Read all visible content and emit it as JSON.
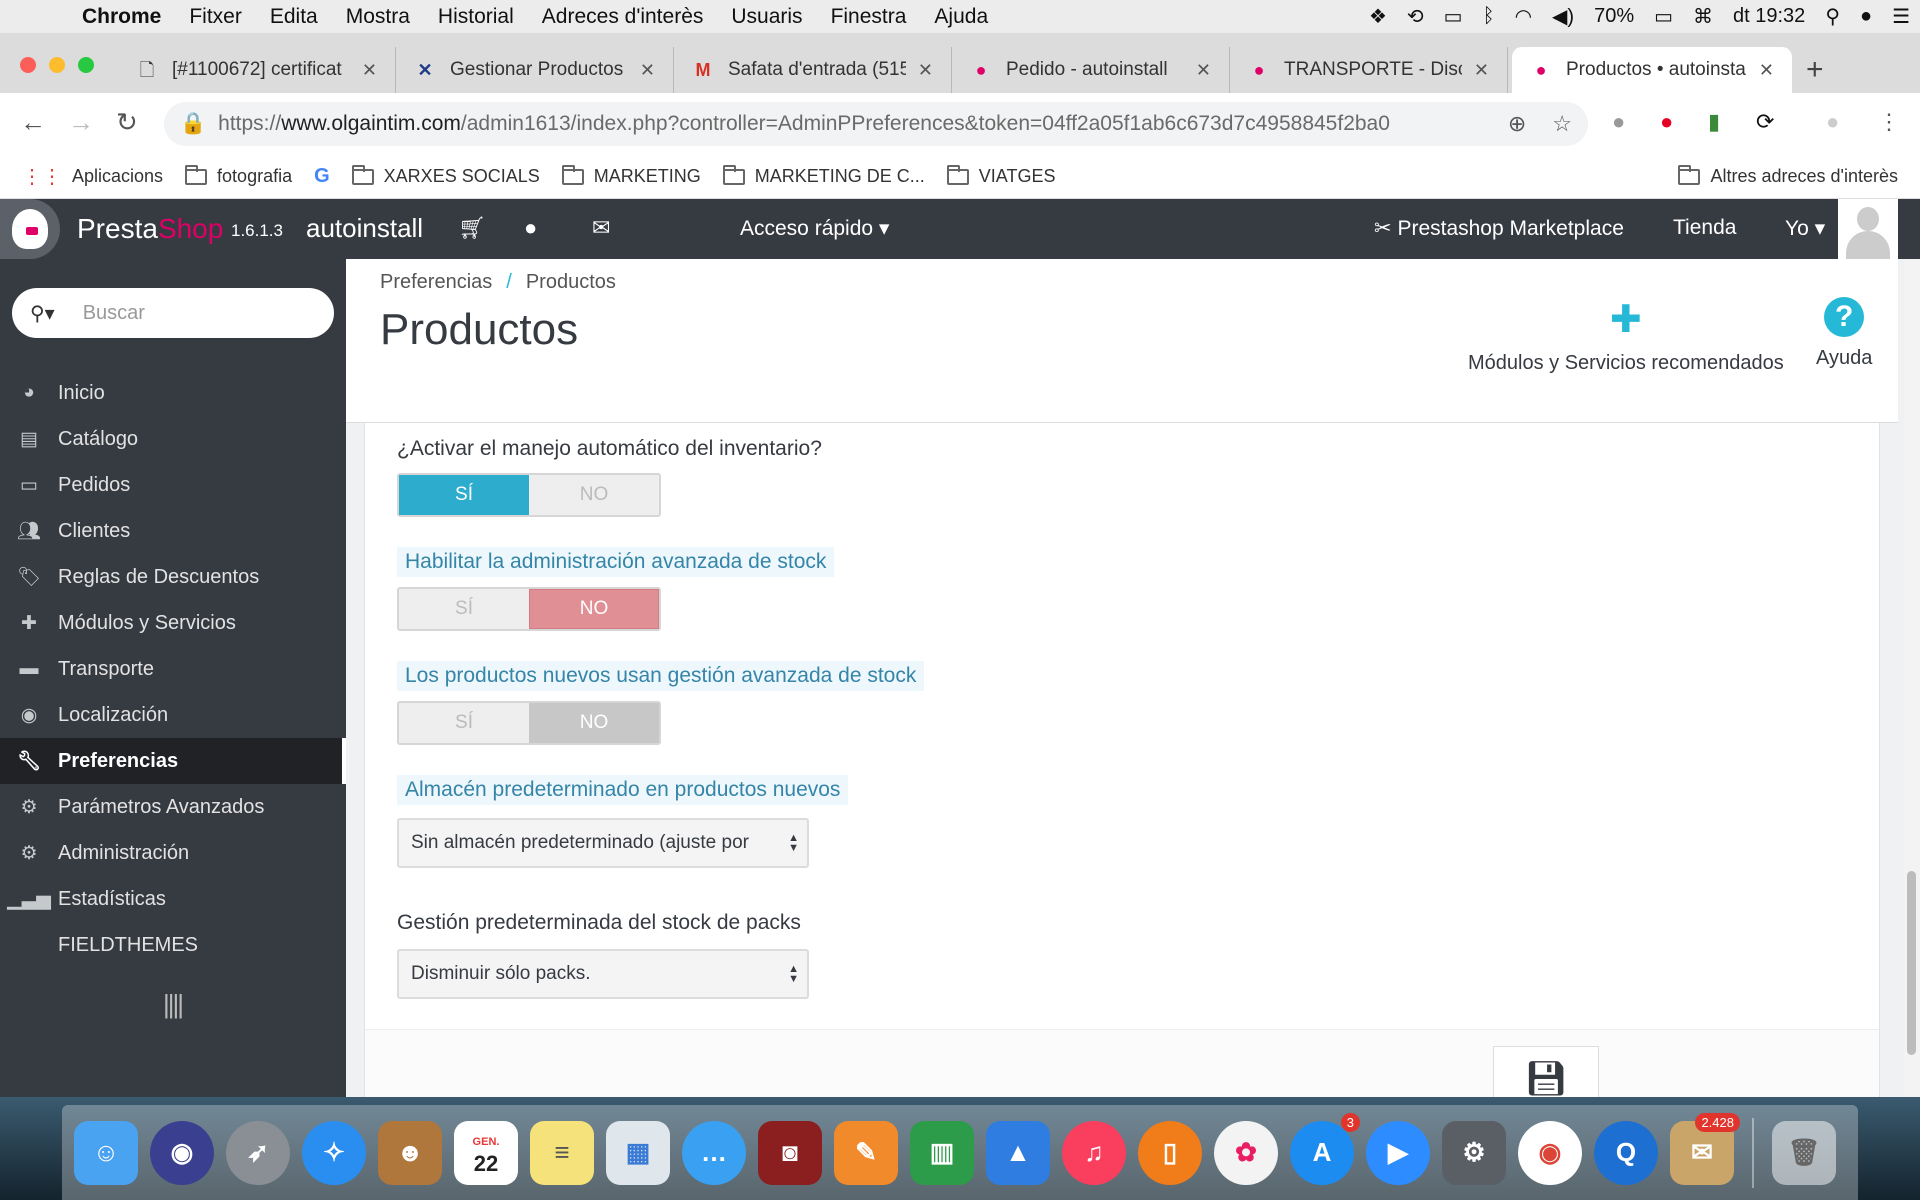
{
  "menubar": {
    "app": "Chrome",
    "items": [
      "Fitxer",
      "Edita",
      "Mostra",
      "Historial",
      "Adreces d'interès",
      "Usuaris",
      "Finestra",
      "Ajuda"
    ],
    "battery": "70%",
    "clock": "dt 19:32"
  },
  "tabs": [
    {
      "title": "[#1100672] certificat",
      "icon": "document-icon"
    },
    {
      "title": "Gestionar Productos",
      "icon": "x-logo-icon"
    },
    {
      "title": "Safata d'entrada (515",
      "icon": "gmail-icon"
    },
    {
      "title": "Pedido - autoinstall",
      "icon": "prestashop-icon"
    },
    {
      "title": "TRANSPORTE - Discu",
      "icon": "prestashop-icon"
    },
    {
      "title": "Productos • autoinsta",
      "icon": "prestashop-icon"
    }
  ],
  "address": {
    "scheme": "https://",
    "host": "www.olgaintim.com",
    "path": "/admin1613/index.php?controller=AdminPPreferences&token=04ff2a05f1ab6c673d7c4958845f2ba0"
  },
  "bookmarks": {
    "apps": "Aplicacions",
    "items": [
      "fotografia",
      "XARXES SOCIALS",
      "MARKETING",
      "MARKETING DE C...",
      "VIATGES"
    ],
    "other": "Altres adreces d'interès"
  },
  "ps_header": {
    "brand_presta": "Presta",
    "brand_shop": "Shop",
    "version": "1.6.1.3",
    "shop_name": "autoinstall",
    "quick_access": "Acceso rápido",
    "marketplace": "Prestashop Marketplace",
    "tienda": "Tienda",
    "yo": "Yo"
  },
  "sidebar": {
    "search_placeholder": "Buscar",
    "items": [
      {
        "label": "Inicio",
        "icon": "dashboard-icon"
      },
      {
        "label": "Catálogo",
        "icon": "book-icon"
      },
      {
        "label": "Pedidos",
        "icon": "credit-card-icon"
      },
      {
        "label": "Clientes",
        "icon": "users-icon"
      },
      {
        "label": "Reglas de Descuentos",
        "icon": "tags-icon"
      },
      {
        "label": "Módulos y Servicios",
        "icon": "puzzle-icon"
      },
      {
        "label": "Transporte",
        "icon": "truck-icon"
      },
      {
        "label": "Localización",
        "icon": "globe-icon"
      },
      {
        "label": "Preferencias",
        "icon": "wrench-icon"
      },
      {
        "label": "Parámetros Avanzados",
        "icon": "cogs-icon"
      },
      {
        "label": "Administración",
        "icon": "cog-icon"
      },
      {
        "label": "Estadísticas",
        "icon": "bar-chart-icon"
      },
      {
        "label": "FIELDTHEMES",
        "icon": ""
      }
    ],
    "active": "Preferencias"
  },
  "page": {
    "breadcrumb": [
      "Preferencias",
      "Productos"
    ],
    "title": "Productos",
    "toolbar": {
      "modules_label": "Módulos y Servicios recomendados",
      "help_label": "Ayuda"
    }
  },
  "form": {
    "auto_stock": {
      "label": "¿Activar el manejo automático del inventario?",
      "yes": "SÍ",
      "no": "NO",
      "value": "SÍ"
    },
    "advanced_stock": {
      "label": "Habilitar la administración avanzada de stock",
      "yes": "SÍ",
      "no": "NO",
      "value": "NO"
    },
    "new_products_asm": {
      "label": "Los productos nuevos usan gestión avanzada de stock",
      "yes": "SÍ",
      "no": "NO",
      "value": "NO"
    },
    "default_warehouse": {
      "label": "Almacén predeterminado en productos nuevos",
      "value": "Sin almacén predeterminado (ajuste por"
    },
    "pack_stock": {
      "label": "Gestión predeterminada del stock de packs",
      "value": "Disminuir sólo packs."
    }
  },
  "dock": {
    "calendar_month": "GEN.",
    "calendar_day": "22",
    "appstore_badge": "3",
    "mail_badge": "2.428"
  },
  "colors": {
    "accent": "#25b9d7",
    "ps_pink": "#df0067",
    "switch_yes": "#2eacce",
    "switch_no_red": "#e08f95",
    "sidebar_bg": "#363a41"
  }
}
